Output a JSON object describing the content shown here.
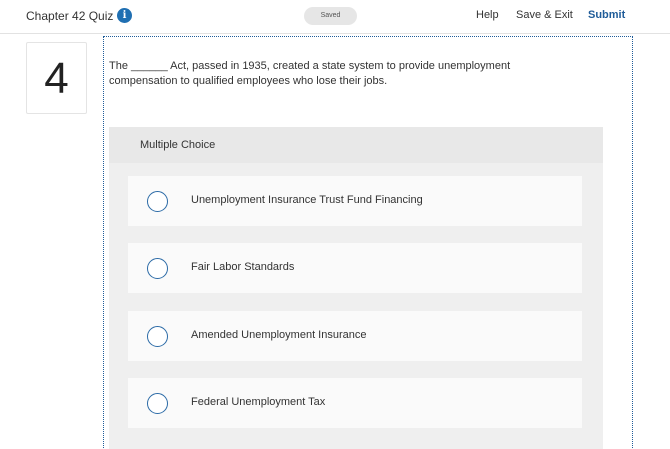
{
  "header": {
    "title": "Chapter 42 Quiz",
    "info_icon": "i",
    "saved_label": "Saved",
    "help_label": "Help",
    "save_exit_label": "Save & Exit",
    "submit_label": "Submit"
  },
  "question": {
    "number": "4",
    "text": "The ______ Act, passed in 1935, created a state system to provide unemployment compensation to qualified employees who lose their jobs.",
    "type_label": "Multiple Choice",
    "choices": [
      {
        "label": "Unemployment Insurance Trust Fund Financing"
      },
      {
        "label": "Fair Labor Standards"
      },
      {
        "label": "Amended Unemployment Insurance"
      },
      {
        "label": "Federal Unemployment Tax"
      }
    ]
  },
  "colors": {
    "accent": "#1f5c99",
    "info_icon": "#1f6fb2",
    "choice_bg": "#fafafa",
    "area_bg": "#efefef"
  }
}
